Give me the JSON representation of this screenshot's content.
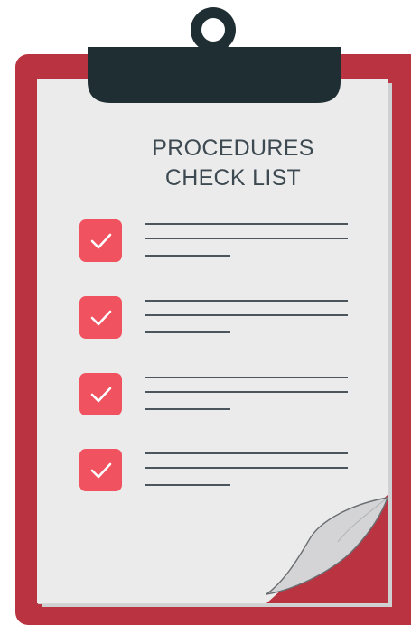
{
  "title": {
    "line1": "PROCEDURES",
    "line2": "CHECK LIST"
  },
  "checklist": [
    {
      "checked": true,
      "icon": "checkmark-icon"
    },
    {
      "checked": true,
      "icon": "checkmark-icon"
    },
    {
      "checked": true,
      "icon": "checkmark-icon"
    },
    {
      "checked": true,
      "icon": "checkmark-icon"
    }
  ],
  "colors": {
    "board": "#b93440",
    "clip": "#1f2e33",
    "paper": "#ebebeb",
    "checkbox": "#f0535f",
    "text": "#3e4a52",
    "lines": "#4a555c"
  }
}
